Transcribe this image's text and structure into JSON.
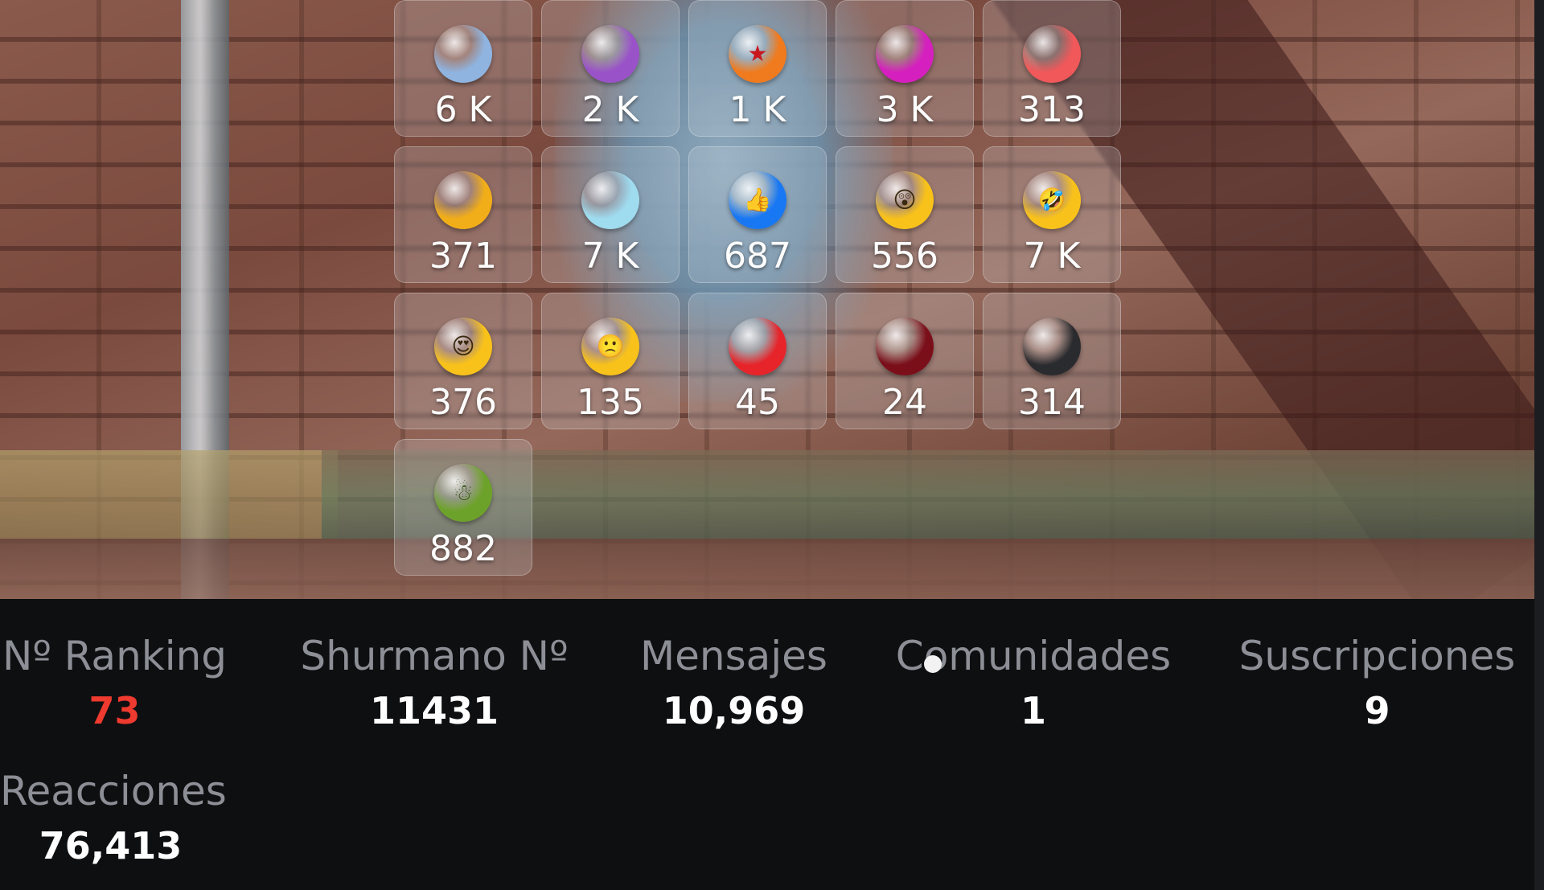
{
  "reactions": [
    {
      "icon": "diamond-blue-icon",
      "color": "#8fb4e0",
      "count": "6 K"
    },
    {
      "icon": "diamond-purple-icon",
      "color": "#9a52c8",
      "count": "2 K"
    },
    {
      "icon": "dragon-ball-icon",
      "color": "#f07a1e",
      "count": "1 K"
    },
    {
      "icon": "diamond-magenta-icon",
      "color": "#d61fbf",
      "count": "3 K"
    },
    {
      "icon": "diamond-coral-icon",
      "color": "#f0585a",
      "count": "313"
    },
    {
      "icon": "diamond-gold-icon",
      "color": "#f2ae18",
      "count": "371"
    },
    {
      "icon": "diamond-crystal-icon",
      "color": "#9fdcf0",
      "count": "7 K"
    },
    {
      "icon": "thumbs-up-icon",
      "color": "#1877f2",
      "count": "687"
    },
    {
      "icon": "surprised-face-icon",
      "color": "#f8c21a",
      "count": "556"
    },
    {
      "icon": "rolling-laughing-face-icon",
      "color": "#f8c21a",
      "count": "7 K"
    },
    {
      "icon": "heart-eyes-face-icon",
      "color": "#f8c21a",
      "count": "376"
    },
    {
      "icon": "sad-face-icon",
      "color": "#f8c21a",
      "count": "135"
    },
    {
      "icon": "diamond-red-icon",
      "color": "#e6242a",
      "count": "45"
    },
    {
      "icon": "diamond-dark-red-icon",
      "color": "#7a0f1a",
      "count": "24"
    },
    {
      "icon": "diamond-black-icon",
      "color": "#2a2b2e",
      "count": "314"
    },
    {
      "icon": "grinch-santa-icon",
      "color": "#6da22a",
      "count": "882"
    }
  ],
  "stats": {
    "ranking": {
      "label": "Nº Ranking",
      "value": "73",
      "color": "#ee3a2f"
    },
    "shurmano": {
      "label": "Shurmano Nº",
      "value": "11431"
    },
    "mensajes": {
      "label": "Mensajes",
      "value": "10,969"
    },
    "comunidades": {
      "label": "Comunidades",
      "value": "1"
    },
    "suscripciones": {
      "label": "Suscripciones",
      "value": "9"
    },
    "reacciones": {
      "label": "Reacciones",
      "value": "76,413"
    }
  }
}
